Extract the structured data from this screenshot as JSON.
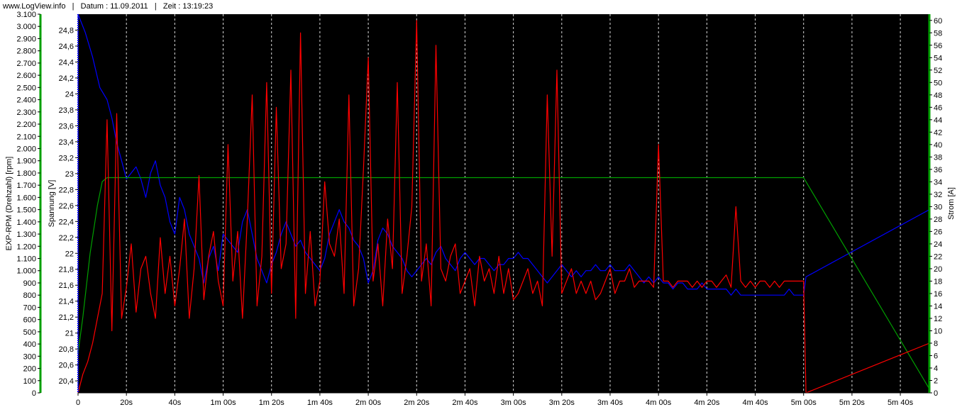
{
  "header": {
    "site": "www.LogView.info",
    "sep1": "|",
    "date_label": "Datum : 11.09.2011",
    "sep2": "|",
    "time_label": "Zeit : 13:19:23"
  },
  "colors": {
    "plot_bg": "#000000",
    "rpm": "#0000ff",
    "current": "#ff0000",
    "voltage": "#00a000",
    "grid": "#ffffff",
    "rpm_axis": "#00a000",
    "voltage_axis": "#0000ff",
    "current_axis": "#00a000"
  },
  "chart_data": {
    "type": "line",
    "grid": "vertical dashed",
    "xlabel": "",
    "x_unit": "seconds",
    "xlim": [
      0,
      352
    ],
    "x_ticks": [
      "0",
      "20s",
      "40s",
      "1m 00s",
      "1m 20s",
      "1m 40s",
      "2m 00s",
      "2m 20s",
      "2m 40s",
      "3m 00s",
      "3m 20s",
      "3m 40s",
      "4m 00s",
      "4m 20s",
      "4m 40s",
      "5m 00s",
      "5m 20s",
      "5m 40s"
    ],
    "x_tick_values": [
      0,
      20,
      40,
      60,
      80,
      100,
      120,
      140,
      160,
      180,
      200,
      220,
      240,
      260,
      280,
      300,
      320,
      340
    ],
    "axes": {
      "rpm": {
        "label": "EXP-RPM (Drehzahl) [rpm]",
        "lim": [
          0,
          3100
        ],
        "ticks": [
          "0",
          "100",
          "200",
          "300",
          "400",
          "500",
          "600",
          "700",
          "800",
          "900",
          "1.000",
          "1.100",
          "1.200",
          "1.300",
          "1.400",
          "1.500",
          "1.600",
          "1.700",
          "1.800",
          "1.900",
          "2.000",
          "2.100",
          "2.200",
          "2.300",
          "2.400",
          "2.500",
          "2.600",
          "2.700",
          "2.800",
          "2.900",
          "3.000",
          "3.100"
        ]
      },
      "voltage": {
        "label": "Spannung [V]",
        "lim": [
          20.25,
          25.0
        ],
        "ticks": [
          "20,4",
          "20,6",
          "20,8",
          "21",
          "21,2",
          "21,4",
          "21,6",
          "21,8",
          "22",
          "22,2",
          "22,4",
          "22,6",
          "22,8",
          "23",
          "23,2",
          "23,4",
          "23,6",
          "23,8",
          "24",
          "24,2",
          "24,4",
          "24,6",
          "24,8"
        ],
        "tick_values": [
          20.4,
          20.6,
          20.8,
          21.0,
          21.2,
          21.4,
          21.6,
          21.8,
          22.0,
          22.2,
          22.4,
          22.6,
          22.8,
          23.0,
          23.2,
          23.4,
          23.6,
          23.8,
          24.0,
          24.2,
          24.4,
          24.6,
          24.8
        ]
      },
      "current": {
        "label": "Strom [A]",
        "lim": [
          0,
          61
        ],
        "ticks": [
          "0",
          "2",
          "4",
          "6",
          "8",
          "10",
          "12",
          "14",
          "16",
          "18",
          "20",
          "22",
          "24",
          "26",
          "28",
          "30",
          "32",
          "34",
          "36",
          "38",
          "40",
          "42",
          "44",
          "46",
          "48",
          "50",
          "52",
          "54",
          "56",
          "58",
          "60"
        ]
      }
    },
    "series": [
      {
        "name": "EXP-RPM (Drehzahl) [rpm]",
        "axis": "rpm",
        "x": [
          0,
          3,
          6,
          9,
          12,
          14,
          16,
          18,
          20,
          22,
          24,
          26,
          28,
          30,
          32,
          34,
          36,
          38,
          40,
          42,
          44,
          46,
          48,
          50,
          52,
          54,
          56,
          58,
          60,
          62,
          64,
          66,
          68,
          70,
          72,
          74,
          76,
          78,
          80,
          82,
          84,
          86,
          88,
          90,
          92,
          94,
          96,
          98,
          100,
          102,
          104,
          106,
          108,
          110,
          112,
          114,
          116,
          118,
          120,
          122,
          124,
          126,
          128,
          130,
          132,
          134,
          136,
          138,
          140,
          142,
          144,
          146,
          148,
          150,
          152,
          154,
          156,
          158,
          160,
          162,
          164,
          166,
          168,
          170,
          172,
          174,
          176,
          178,
          180,
          182,
          184,
          186,
          188,
          190,
          192,
          194,
          196,
          198,
          200,
          202,
          204,
          206,
          208,
          210,
          212,
          214,
          216,
          218,
          220,
          222,
          224,
          226,
          228,
          230,
          232,
          234,
          236,
          238,
          240,
          242,
          244,
          246,
          248,
          250,
          252,
          254,
          256,
          258,
          260,
          262,
          264,
          266,
          268,
          270,
          272,
          274,
          276,
          278,
          280,
          282,
          284,
          286,
          288,
          290,
          292,
          294,
          296,
          298,
          300,
          301,
          352
        ],
        "values": [
          3100,
          2950,
          2750,
          2500,
          2400,
          2250,
          2050,
          1900,
          1750,
          1800,
          1850,
          1750,
          1600,
          1800,
          1900,
          1700,
          1600,
          1400,
          1300,
          1600,
          1500,
          1300,
          1200,
          1100,
          900,
          1100,
          1200,
          1000,
          1300,
          1250,
          1200,
          1150,
          1400,
          1500,
          1300,
          1100,
          1000,
          900,
          1050,
          1150,
          1300,
          1400,
          1300,
          1200,
          1250,
          1150,
          1100,
          1050,
          1000,
          1100,
          1300,
          1400,
          1500,
          1400,
          1350,
          1250,
          1200,
          1100,
          900,
          1000,
          1250,
          1350,
          1300,
          1200,
          1150,
          1100,
          1000,
          950,
          1000,
          1050,
          1100,
          1050,
          1150,
          1200,
          1100,
          1050,
          1000,
          1100,
          1150,
          1100,
          1050,
          1100,
          1100,
          1050,
          1000,
          1050,
          1050,
          1100,
          1100,
          1150,
          1100,
          1100,
          1050,
          1000,
          950,
          900,
          950,
          1000,
          1050,
          1000,
          950,
          1000,
          950,
          1000,
          1000,
          1050,
          1000,
          1000,
          1050,
          1000,
          1000,
          1000,
          1050,
          1000,
          950,
          900,
          950,
          900,
          950,
          900,
          900,
          850,
          900,
          900,
          850,
          850,
          850,
          900,
          850,
          850,
          850,
          850,
          850,
          800,
          850,
          800,
          800,
          800,
          800,
          800,
          800,
          800,
          800,
          800,
          800,
          850,
          800,
          800,
          800,
          950,
          1500
        ]
      },
      {
        "name": "Spannung [V]",
        "axis": "voltage",
        "x": [
          0,
          2,
          5,
          8,
          10,
          12,
          15,
          20,
          30,
          40,
          60,
          80,
          100,
          120,
          140,
          160,
          180,
          200,
          220,
          240,
          260,
          280,
          300,
          352
        ],
        "values": [
          20.75,
          21.2,
          22.0,
          22.6,
          22.9,
          22.95,
          22.95,
          22.95,
          22.95,
          22.95,
          22.95,
          22.95,
          22.95,
          22.95,
          22.95,
          22.95,
          22.95,
          22.95,
          22.95,
          22.95,
          22.95,
          22.95,
          22.95,
          20.3
        ]
      },
      {
        "name": "Strom [A]",
        "axis": "current",
        "x": [
          0,
          2,
          4,
          6,
          8,
          10,
          12,
          14,
          16,
          18,
          20,
          22,
          24,
          26,
          28,
          30,
          32,
          34,
          36,
          38,
          40,
          42,
          44,
          46,
          48,
          50,
          52,
          54,
          56,
          58,
          60,
          62,
          64,
          66,
          68,
          70,
          72,
          74,
          76,
          78,
          80,
          82,
          84,
          86,
          88,
          90,
          92,
          94,
          96,
          98,
          100,
          102,
          104,
          106,
          108,
          110,
          112,
          114,
          116,
          118,
          120,
          122,
          124,
          126,
          128,
          130,
          132,
          134,
          136,
          138,
          140,
          142,
          144,
          146,
          148,
          150,
          152,
          154,
          156,
          158,
          160,
          162,
          164,
          166,
          168,
          170,
          172,
          174,
          176,
          178,
          180,
          182,
          184,
          186,
          188,
          190,
          192,
          194,
          196,
          198,
          200,
          202,
          204,
          206,
          208,
          210,
          212,
          214,
          216,
          218,
          220,
          222,
          224,
          226,
          228,
          230,
          232,
          234,
          236,
          238,
          240,
          242,
          244,
          246,
          248,
          250,
          252,
          254,
          256,
          258,
          260,
          262,
          264,
          266,
          268,
          270,
          272,
          274,
          276,
          278,
          280,
          282,
          284,
          286,
          288,
          290,
          292,
          294,
          296,
          298,
          300,
          301,
          352
        ],
        "values": [
          0,
          3,
          5,
          8,
          12,
          16,
          44,
          10,
          45,
          12,
          17,
          24,
          13,
          20,
          22,
          16,
          12,
          25,
          16,
          22,
          14,
          20,
          28,
          12,
          20,
          35,
          15,
          22,
          26,
          18,
          14,
          40,
          18,
          26,
          12,
          28,
          48,
          14,
          22,
          50,
          16,
          46,
          20,
          24,
          52,
          12,
          58,
          16,
          26,
          14,
          18,
          34,
          24,
          22,
          28,
          16,
          48,
          14,
          20,
          36,
          54,
          18,
          24,
          14,
          28,
          20,
          50,
          16,
          22,
          30,
          60,
          18,
          24,
          14,
          56,
          20,
          18,
          22,
          24,
          16,
          18,
          20,
          14,
          22,
          18,
          20,
          16,
          22,
          16,
          20,
          15,
          16,
          18,
          20,
          16,
          18,
          14,
          48,
          22,
          52,
          16,
          18,
          20,
          16,
          18,
          16,
          18,
          15,
          16,
          18,
          20,
          16,
          18,
          18,
          20,
          17,
          18,
          18,
          18,
          17,
          40,
          18,
          18,
          17,
          18,
          18,
          18,
          17,
          18,
          17,
          18,
          18,
          17,
          18,
          19,
          17,
          30,
          18,
          17,
          18,
          17,
          18,
          18,
          17,
          18,
          17,
          18,
          18,
          18,
          18,
          18,
          0,
          8
        ]
      }
    ]
  }
}
